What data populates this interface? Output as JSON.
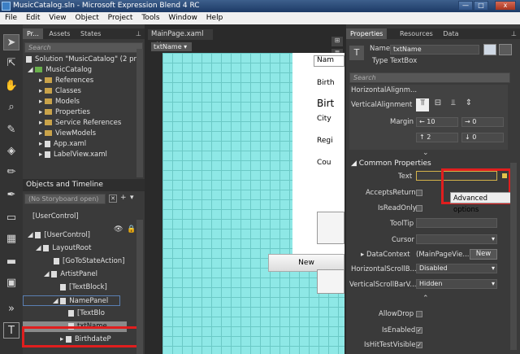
{
  "window": {
    "title": "MusicCatalog.sln - Microsoft Expression Blend 4 RC",
    "min": "—",
    "max": "□",
    "close": "x"
  },
  "menu": [
    "File",
    "Edit",
    "View",
    "Object",
    "Project",
    "Tools",
    "Window",
    "Help"
  ],
  "project_panel": {
    "tabs": [
      "Pr...",
      "Assets",
      "States"
    ],
    "search_placeholder": "Search",
    "solution": "Solution \"MusicCatalog\" (2 pr",
    "project": "MusicCatalog",
    "items": [
      "References",
      "Classes",
      "Models",
      "Properties",
      "Service References",
      "ViewModels",
      "App.xaml",
      "LabelView.xaml"
    ]
  },
  "objects_panel": {
    "title": "Objects and Timeline",
    "storyboard": "(No Storyboard open)",
    "root_header": "[UserControl]",
    "tree": [
      {
        "label": "[UserControl]",
        "indent": 0
      },
      {
        "label": "LayoutRoot",
        "indent": 1
      },
      {
        "label": "[GoToStateAction]",
        "indent": 2
      },
      {
        "label": "ArtistPanel",
        "indent": 2
      },
      {
        "label": "[TextBlock]",
        "indent": 3
      },
      {
        "label": "NamePanel",
        "indent": 3
      },
      {
        "label": "[TextBlo",
        "indent": 4
      },
      {
        "label": "txtName",
        "indent": 4
      },
      {
        "label": "BirthdateP",
        "indent": 3
      }
    ]
  },
  "document": {
    "tab": "MainPage.xaml",
    "breadcrumb": "txtName",
    "labels": [
      "Nam",
      "Birth",
      "Birt",
      "City",
      "Regi",
      "Cou"
    ],
    "new_button": "New"
  },
  "properties": {
    "tabs": [
      "Properties",
      "Resources",
      "Data"
    ],
    "name_label": "Name",
    "name_value": "txtName",
    "type_label": "Type",
    "type_value": "TextBox",
    "search_placeholder": "Search",
    "layout": {
      "horizontal_alignment": "HorizontalAlignm...",
      "vertical_alignment": "VerticalAlignment",
      "margin": "Margin",
      "margin_values": [
        "10",
        "0",
        "2",
        "0"
      ]
    },
    "common": {
      "header": "Common Properties",
      "text": "Text",
      "accepts_return": "AcceptsReturn",
      "is_read_only": "IsReadOnly",
      "tooltip": "ToolTip",
      "cursor": "Cursor",
      "data_context": "DataContext",
      "data_context_value": "(MainPageVie...",
      "new": "New",
      "hscroll": "HorizontalScrollB...",
      "hscroll_value": "Disabled",
      "vscroll": "VerticalScrollBarV...",
      "vscroll_value": "Hidden",
      "allow_drop": "AllowDrop",
      "is_enabled": "IsEnabled",
      "is_hit_test": "IsHitTestVisible",
      "advanced_tooltip": "Advanced options"
    }
  },
  "colors": {
    "accent_highlight": "#e01e1e",
    "canvas": "#8ee8e6"
  }
}
